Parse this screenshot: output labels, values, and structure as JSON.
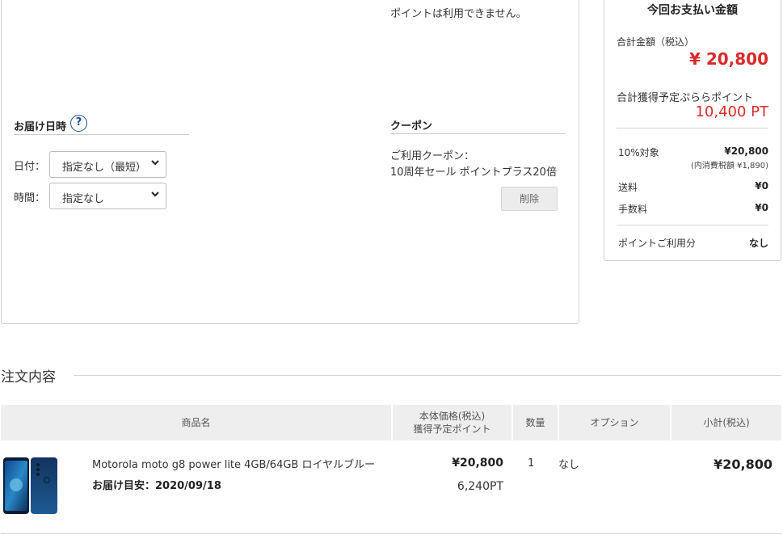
{
  "points_note": "ポイントは利用できません。",
  "delivery": {
    "title": "お届け日時",
    "help_glyph": "?",
    "date_label": "日付：",
    "date_value": "指定なし（最短）",
    "time_label": "時間：",
    "time_value": "指定なし"
  },
  "coupon": {
    "title": "クーポン",
    "label": "ご利用クーポン：",
    "name": "10周年セール ポイントプラス20倍",
    "delete_label": "削除"
  },
  "summary": {
    "title": "今回お支払い金額",
    "total_label": "合計金額（税込）",
    "total_amount": "¥ 20,800",
    "points_label": "合計獲得予定ぷららポイント",
    "points_value": "10,400 PT",
    "rows": [
      {
        "label": "10%対象",
        "value": "¥20,800",
        "sub": "(内消費税額 ¥1,890)"
      },
      {
        "label": "送料",
        "value": "¥0"
      },
      {
        "label": "手数料",
        "value": "¥0"
      },
      {
        "label": "ポイントご利用分",
        "value": "なし"
      }
    ],
    "accent_color": "#d92a2a"
  },
  "order": {
    "title": "注文内容",
    "headers": {
      "product": "商品名",
      "price_line1": "本体価格(税込)",
      "price_line2": "獲得予定ポイント",
      "qty": "数量",
      "option": "オプション",
      "subtotal": "小計(税込)"
    },
    "item": {
      "name": "Motorola moto g8 power lite 4GB/64GB ロイヤルブルー",
      "delivery_estimate": "お届け目安：2020/09/18",
      "price": "¥20,800",
      "points": "6,240PT",
      "qty": "1",
      "option": "なし",
      "subtotal": "¥20,800",
      "image_icon": "phone-product-image"
    }
  }
}
